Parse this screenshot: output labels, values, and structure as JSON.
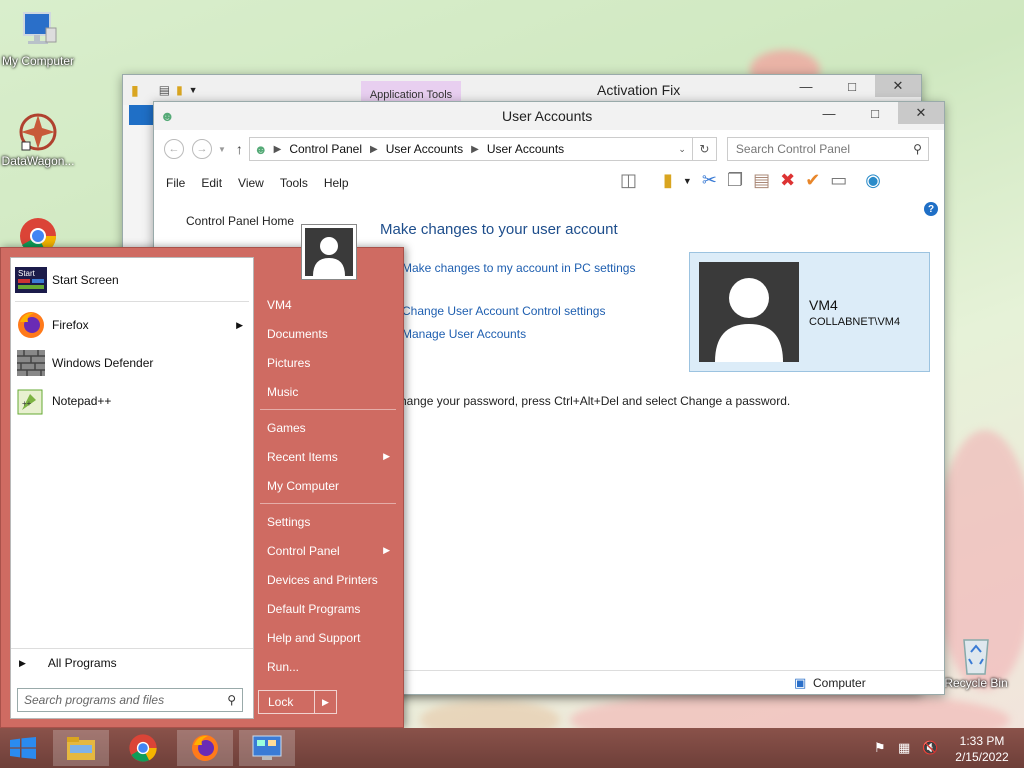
{
  "desktop": {
    "icons": [
      {
        "label": "My Computer"
      },
      {
        "label": "DataWagon..."
      },
      {
        "label": "Recycle Bin"
      }
    ]
  },
  "activation_window": {
    "ribbon_tab": "Application Tools",
    "title": "Activation Fix"
  },
  "user_accounts": {
    "title": "User Accounts",
    "breadcrumb": [
      "Control Panel",
      "User Accounts",
      "User Accounts"
    ],
    "search_placeholder": "Search Control Panel",
    "menu": [
      "File",
      "Edit",
      "View",
      "Tools",
      "Help"
    ],
    "sidebar_link": "Control Panel Home",
    "heading": "Make changes to your user account",
    "links": [
      "Make changes to my account in PC settings",
      "Change User Account Control settings",
      "Manage User Accounts"
    ],
    "password_note": "hange your password, press Ctrl+Alt+Del and select Change a password.",
    "user_name": "VM4",
    "user_domain": "COLLABNET\\VM4",
    "status_bar": "Computer"
  },
  "start_menu": {
    "programs": [
      {
        "label": "Start Screen",
        "icon": "start-screen-icon"
      },
      {
        "label": "Firefox",
        "icon": "firefox-icon"
      },
      {
        "label": "Windows Defender",
        "icon": "defender-icon"
      },
      {
        "label": "Notepad++",
        "icon": "notepadpp-icon"
      }
    ],
    "all_programs": "All Programs",
    "search_placeholder": "Search programs and files",
    "right_items": [
      {
        "label": "VM4"
      },
      {
        "label": "Documents"
      },
      {
        "label": "Pictures"
      },
      {
        "label": "Music"
      },
      {
        "label": "Games"
      },
      {
        "label": "Recent Items"
      },
      {
        "label": "My Computer"
      },
      {
        "label": "Settings"
      },
      {
        "label": "Control Panel"
      },
      {
        "label": "Devices and Printers"
      },
      {
        "label": "Default Programs"
      },
      {
        "label": "Help and Support"
      },
      {
        "label": "Run..."
      }
    ],
    "lock_label": "Lock"
  },
  "taskbar": {
    "time": "1:33 PM",
    "date": "2/15/2022"
  },
  "colors": {
    "start_menu_bg": "#cf6b62",
    "taskbar_bg": "#7d4a43",
    "link": "#1f5fb0"
  }
}
